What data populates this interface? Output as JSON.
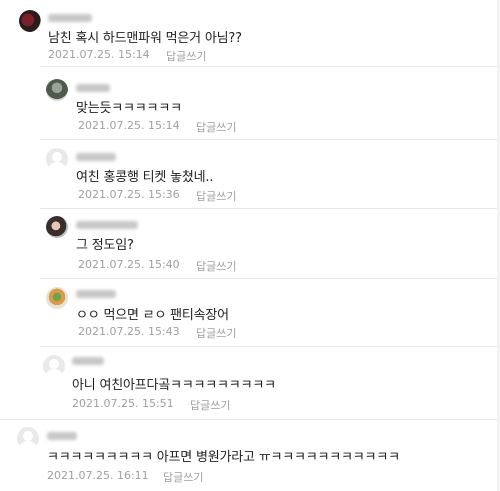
{
  "comments": [
    {
      "author": "",
      "text": "남친 혹시 하드맨파워 먹은거 아님??",
      "time": "2021.07.25. 15:14",
      "reply": "답글쓰기"
    },
    {
      "author": "",
      "text": "맞는듯ㅋㅋㅋㅋㅋㅋ",
      "time": "2021.07.25. 15:14",
      "reply": "답글쓰기"
    },
    {
      "author": "",
      "text": "여친 홍콩행 티켓 놓쳤네..",
      "time": "2021.07.25. 15:36",
      "reply": "답글쓰기"
    },
    {
      "author": "",
      "text": "그 정도임?",
      "time": "2021.07.25. 15:40",
      "reply": "답글쓰기"
    },
    {
      "author": "",
      "text": "ㅇㅇ 먹으면 ㄹㅇ 팬티속장어",
      "time": "2021.07.25. 15:43",
      "reply": "답글쓰기"
    },
    {
      "author": "",
      "text": "아니 여친아프다곸ㅋㅋㅋㅋㅋㅋㅋㅋㅋ",
      "time": "2021.07.25. 15:51",
      "reply": "답글쓰기"
    },
    {
      "author": "",
      "text": "ㅋㅋㅋㅋㅋㅋㅋㅋㅋ 아프면 병원가라고 ㅠㅋㅋㅋㅋㅋㅋㅋㅋㅋㅋㅋ",
      "time": "2021.07.25. 16:11",
      "reply": "답글쓰기"
    }
  ]
}
